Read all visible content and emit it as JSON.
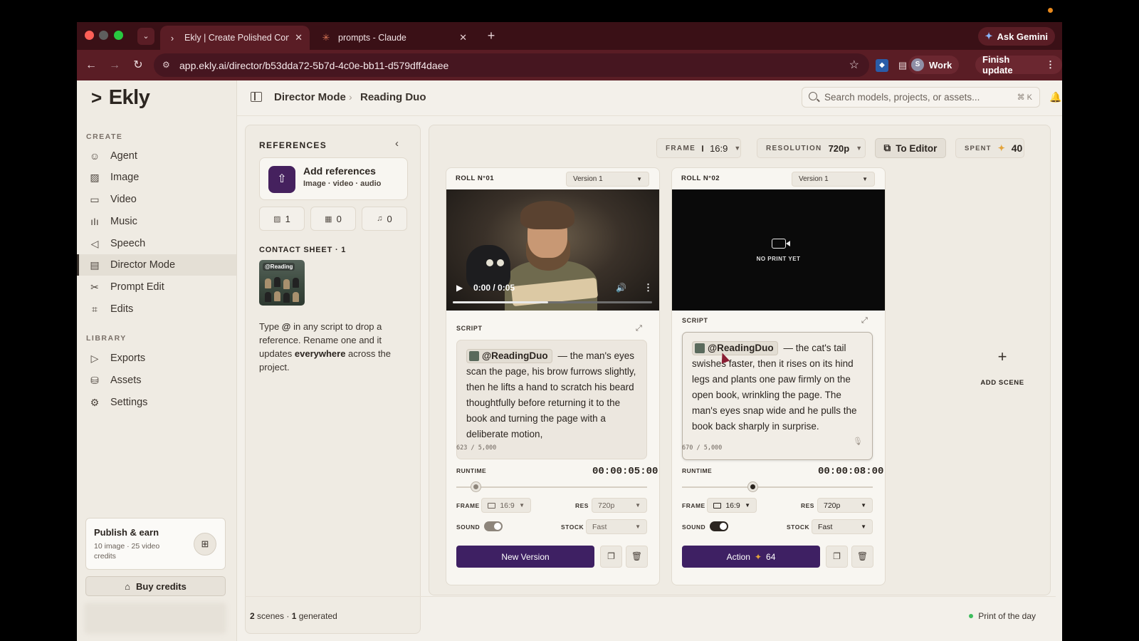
{
  "browser": {
    "tabs": [
      {
        "title": "Ekly | Create Polished Conten",
        "active": true
      },
      {
        "title": "prompts - Claude",
        "active": false
      }
    ],
    "ask_gemini": "Ask Gemini",
    "url": "app.ekly.ai/director/b53dda72-5b7d-4c0e-bb11-d579dff4daee",
    "profile_initial": "S",
    "profile_label": "Work",
    "finish_update": "Finish update",
    "colors": {
      "tabbar": "#3a1016",
      "toolbar": "#5a1d25"
    }
  },
  "app": {
    "logo": "Ekly",
    "sidebar": {
      "create_heading": "CREATE",
      "create_items": [
        {
          "label": "Agent",
          "icon": "agent-icon"
        },
        {
          "label": "Image",
          "icon": "image-icon"
        },
        {
          "label": "Video",
          "icon": "video-icon"
        },
        {
          "label": "Music",
          "icon": "music-icon"
        },
        {
          "label": "Speech",
          "icon": "speech-icon"
        },
        {
          "label": "Director Mode",
          "icon": "director-icon",
          "active": true
        },
        {
          "label": "Prompt Edit",
          "icon": "scissors-icon"
        },
        {
          "label": "Edits",
          "icon": "edits-icon"
        }
      ],
      "library_heading": "LIBRARY",
      "library_items": [
        {
          "label": "Exports",
          "icon": "play-icon"
        },
        {
          "label": "Assets",
          "icon": "assets-icon"
        },
        {
          "label": "Settings",
          "icon": "gear-icon"
        }
      ],
      "publish": {
        "title": "Publish & earn",
        "subtitle": "10 image · 25 video credits"
      },
      "buy_credits": "Buy credits"
    },
    "header": {
      "breadcrumb": [
        "Director Mode",
        "Reading Duo"
      ],
      "search_placeholder": "Search models, projects, or assets...",
      "search_shortcut": "⌘ K"
    },
    "references": {
      "title": "REFERENCES",
      "add_title": "Add references",
      "add_subtitle": "Image · video · audio",
      "counts": {
        "images": "1",
        "videos": "0",
        "audio": "0"
      },
      "contact_sheet_title": "CONTACT SHEET · 1",
      "thumb_tag": "@Reading",
      "hint_pre": "Type ",
      "hint_at": "@",
      "hint_mid": " in any script to drop a reference. Rename one and it updates ",
      "hint_bold": "everywhere",
      "hint_post": " across the project."
    },
    "toolbar": {
      "frame_label": "FRAME",
      "frame_value": "16:9",
      "resolution_label": "RESOLUTION",
      "resolution_value": "720p",
      "to_editor": "To Editor",
      "spent_label": "SPENT",
      "spent_value": "40",
      "accent": "#3e2063"
    },
    "rolls": [
      {
        "number": "ROLL N°01",
        "version": "Version 1",
        "player": {
          "time": "0:00 / 0:05",
          "progress": 0.48
        },
        "script_label": "SCRIPT",
        "mention": "@ReadingDuo",
        "script_text": "— the man's eyes scan the page, his brow furrows slightly, then he lifts a hand to scratch his beard thoughtfully before returning it to the book and turning the page with a deliberate motion,",
        "char_count": "623 / 5,000",
        "runtime_label": "RUNTIME",
        "runtime_value": "00:00:05:00",
        "runtime_fraction": 0.1,
        "frame_label": "FRAME",
        "frame_value": "16:9",
        "res_label": "RES",
        "res_value": "720p",
        "sound_label": "SOUND",
        "sound_on": true,
        "stock_label": "STOCK",
        "stock_value": "Fast",
        "action_label": "New Version",
        "action_cost": ""
      },
      {
        "number": "ROLL N°02",
        "version": "Version 1",
        "no_print": "NO PRINT YET",
        "script_label": "SCRIPT",
        "mention": "@ReadingDuo",
        "script_text": "— the cat's tail swishes faster, then it rises on its hind legs and plants one paw firmly on the open book, wrinkling the page. The man's eyes snap wide and he pulls the book back sharply in surprise.",
        "char_count": "670 / 5,000",
        "runtime_label": "RUNTIME",
        "runtime_value": "00:00:08:00",
        "runtime_fraction": 0.37,
        "frame_label": "FRAME",
        "frame_value": "16:9",
        "res_label": "RES",
        "res_value": "720p",
        "sound_label": "SOUND",
        "sound_on": true,
        "stock_label": "STOCK",
        "stock_value": "Fast",
        "action_label": "Action",
        "action_cost": "64"
      }
    ],
    "add_scene": "ADD SCENE",
    "footer": {
      "scenes_count": "2",
      "scenes_text": " scenes · ",
      "generated_count": "1",
      "generated_text": " generated",
      "status": "Print of the day"
    }
  }
}
